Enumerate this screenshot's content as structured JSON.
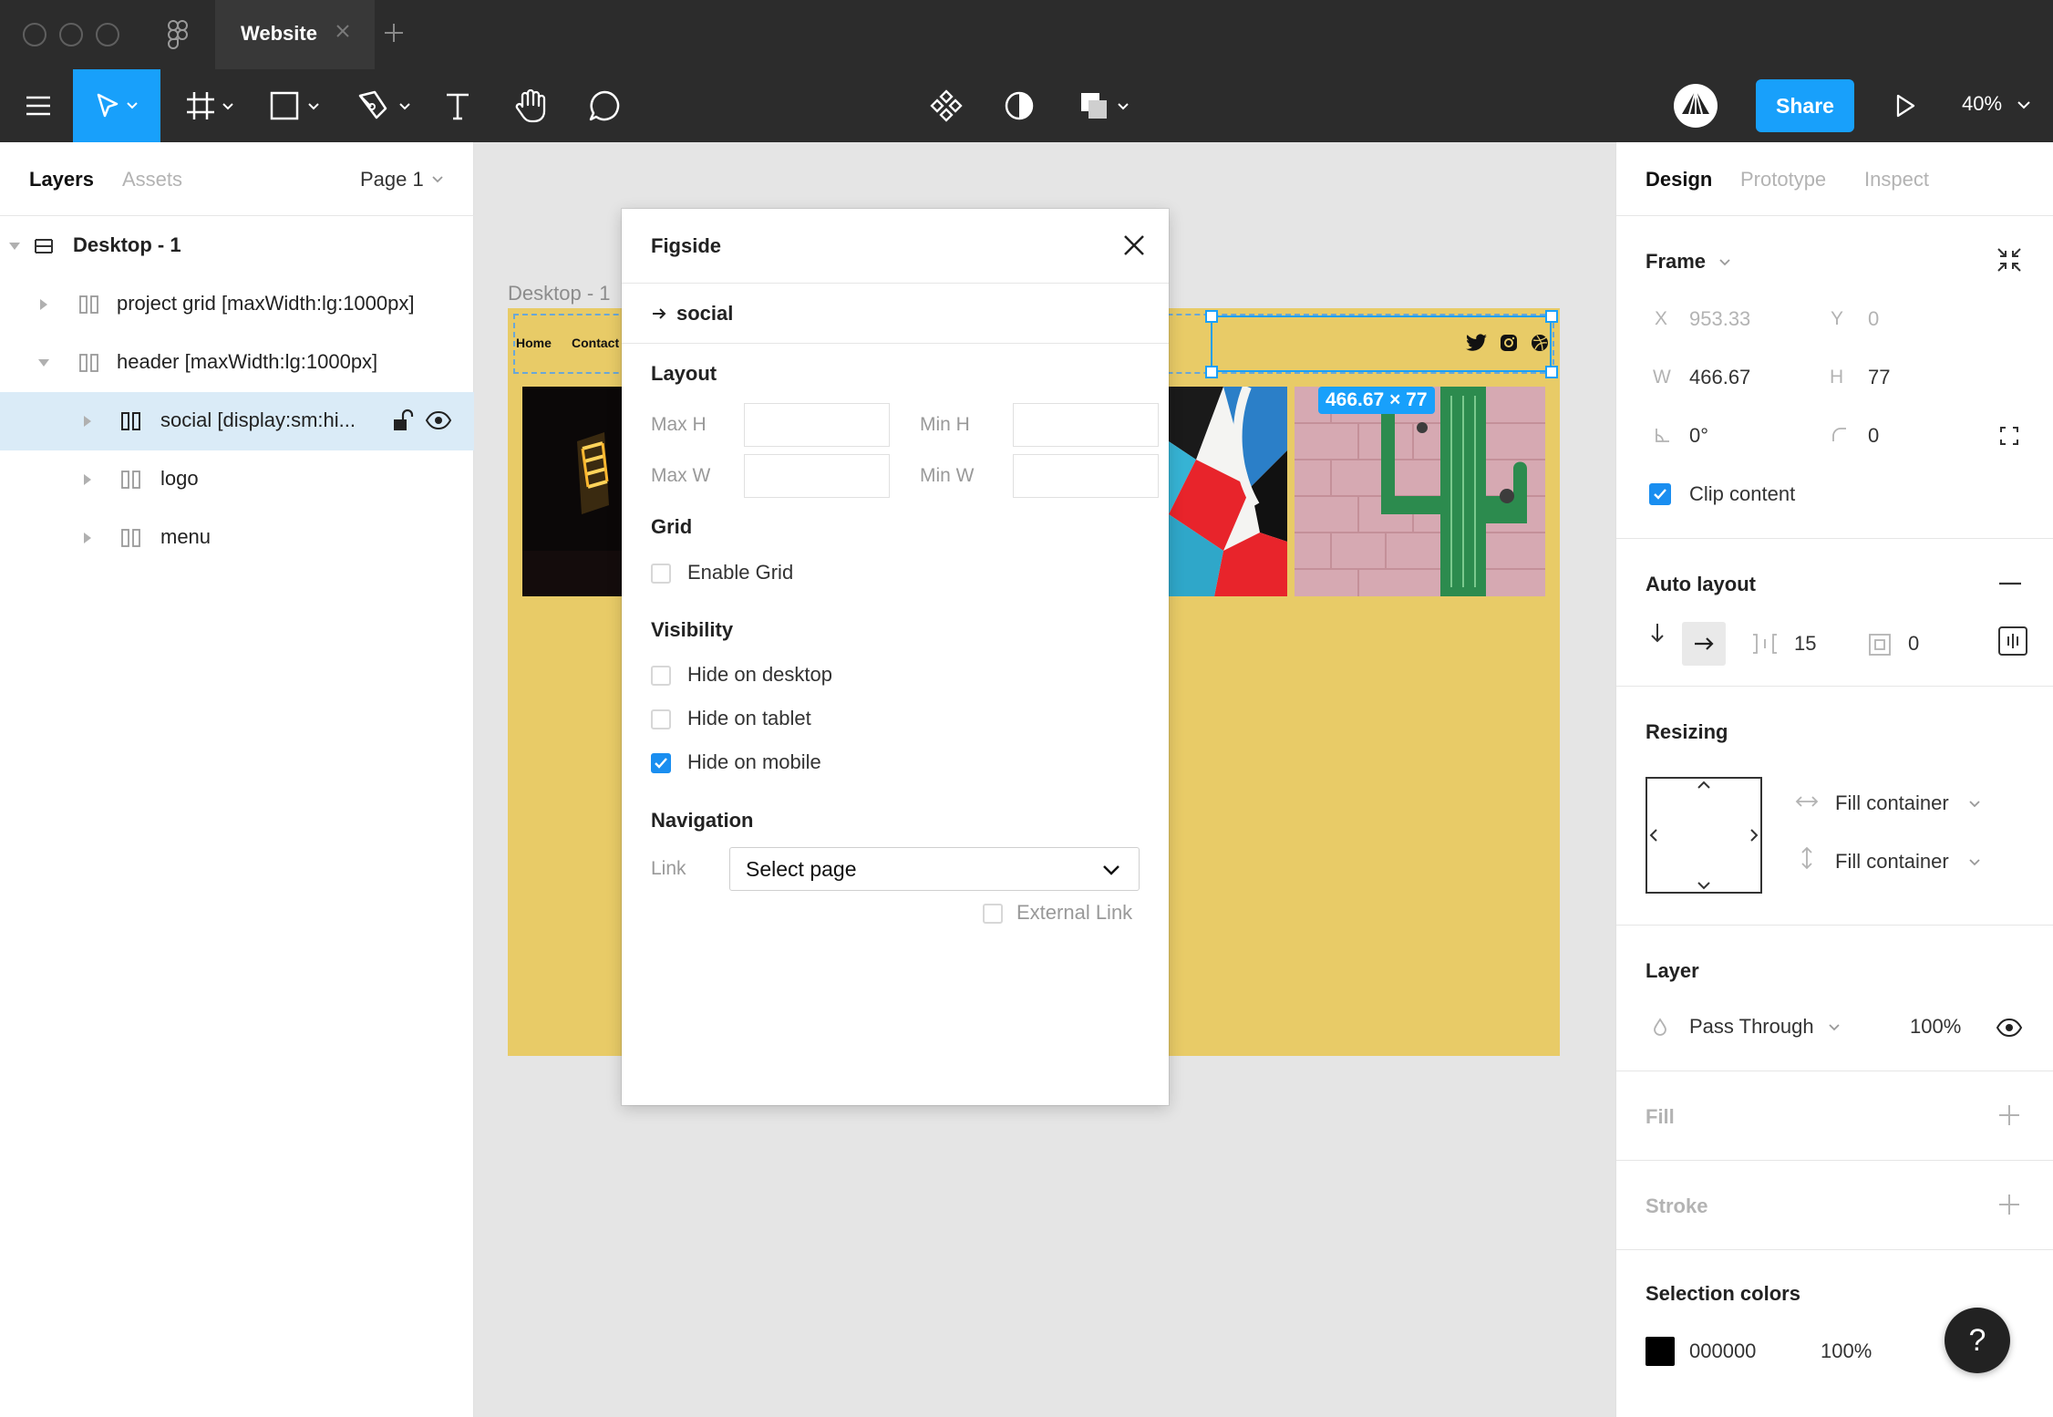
{
  "window": {
    "tab_title": "Website"
  },
  "toolbar": {
    "share_label": "Share",
    "zoom": "40%"
  },
  "left_panel": {
    "tabs": [
      "Layers",
      "Assets"
    ],
    "page_selector": "Page 1",
    "layers": [
      {
        "label": "Desktop - 1"
      },
      {
        "label": "project grid [maxWidth:lg:1000px]"
      },
      {
        "label": "header [maxWidth:lg:1000px]"
      },
      {
        "label": "social [display:sm:hi..."
      },
      {
        "label": "logo"
      },
      {
        "label": "menu"
      }
    ]
  },
  "canvas": {
    "frame_label": "Desktop - 1",
    "nav": [
      "Home",
      "Contact"
    ],
    "dimension_badge": "466.67 × 77"
  },
  "plugin": {
    "title": "Figside",
    "target": "social",
    "sections": {
      "layout": "Layout",
      "grid": "Grid",
      "visibility": "Visibility",
      "navigation": "Navigation"
    },
    "fields": {
      "max_h": "Max H",
      "min_h": "Min H",
      "max_w": "Max W",
      "min_w": "Min W"
    },
    "enable_grid": "Enable Grid",
    "visibility_options": [
      {
        "label": "Hide on desktop",
        "checked": false
      },
      {
        "label": "Hide on tablet",
        "checked": false
      },
      {
        "label": "Hide on mobile",
        "checked": true
      }
    ],
    "link_label": "Link",
    "link_select": "Select page",
    "external_link": "External Link"
  },
  "right_panel": {
    "tabs": [
      "Design",
      "Prototype",
      "Inspect"
    ],
    "frame": {
      "heading": "Frame",
      "x_label": "X",
      "x": "953.33",
      "y_label": "Y",
      "y": "0",
      "w_label": "W",
      "w": "466.67",
      "h_label": "H",
      "h": "77",
      "rotation": "0°",
      "radius": "0",
      "clip_content": "Clip content"
    },
    "auto_layout": {
      "heading": "Auto layout",
      "spacing": "15",
      "padding": "0"
    },
    "resizing": {
      "heading": "Resizing",
      "horizontal": "Fill container",
      "vertical": "Fill container"
    },
    "layer": {
      "heading": "Layer",
      "blend": "Pass Through",
      "opacity": "100%"
    },
    "fill": {
      "heading": "Fill"
    },
    "stroke": {
      "heading": "Stroke"
    },
    "selection_colors": {
      "heading": "Selection colors",
      "hex": "000000",
      "opacity": "100%"
    }
  },
  "help_label": "?",
  "colors": {
    "accent": "#18a0fb",
    "frame_bg": "#e8cb67",
    "toolbar_bg": "#2c2c2c"
  }
}
